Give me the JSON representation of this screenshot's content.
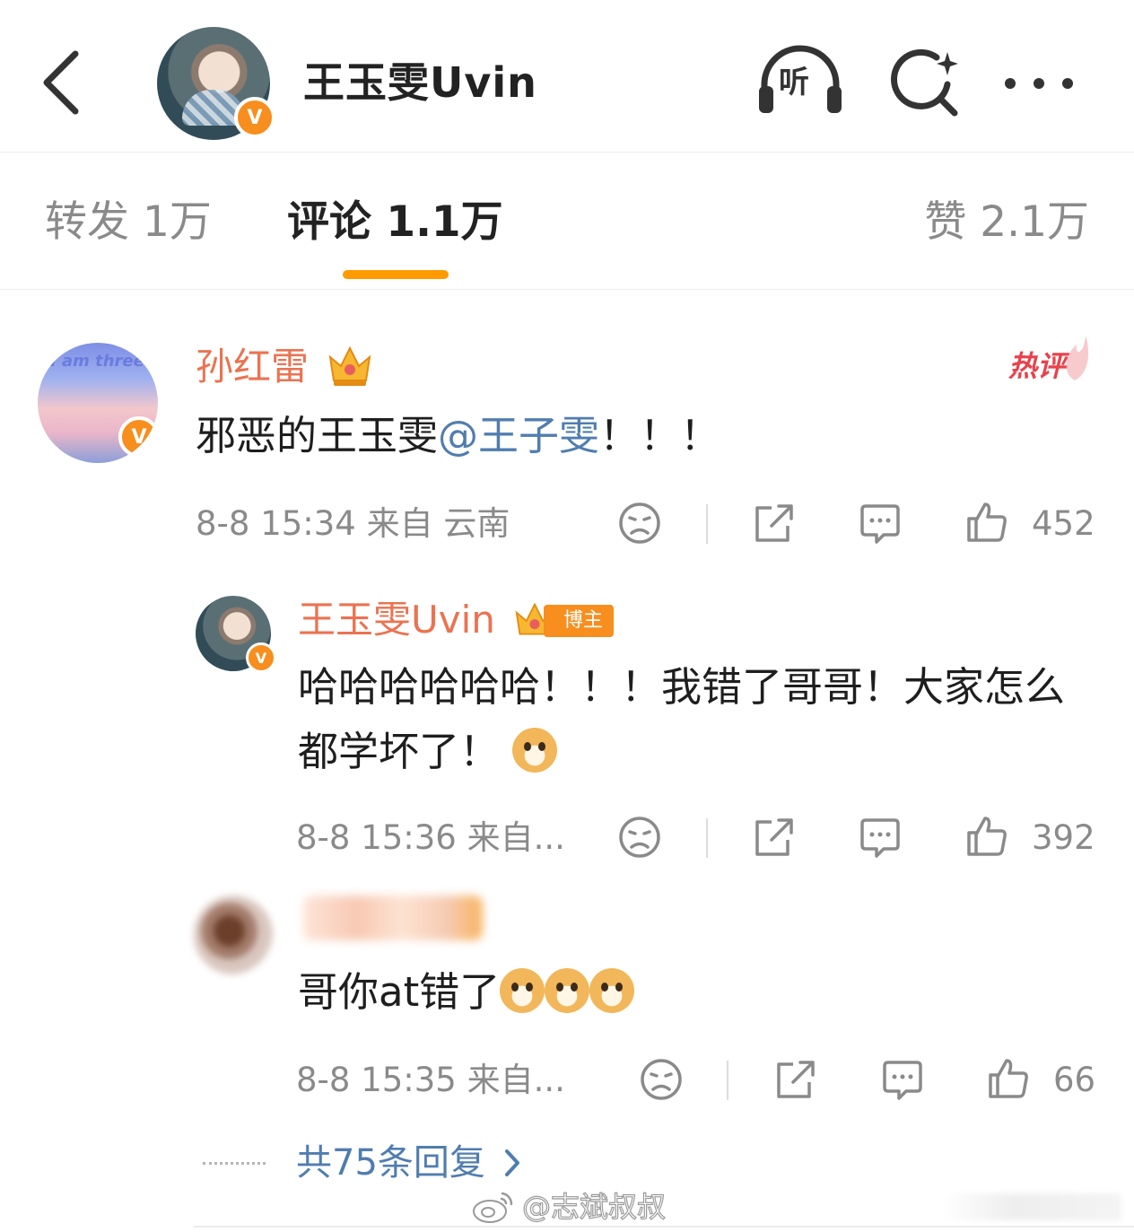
{
  "header": {
    "back_icon": "chevron-left-icon",
    "title": "王玉雯Uvin",
    "verified_badge": "V",
    "listen_label": "听",
    "search_icon": "search-sparkle-icon",
    "more_icon": "more-dots-icon"
  },
  "tabs": {
    "repost": "转发 1万",
    "comment": "评论 1.1万",
    "like": "赞 2.1万",
    "active_color": "#ff9a00"
  },
  "comments": [
    {
      "avatar_text": "I am three",
      "username": "孙红雷",
      "verified_badge": "V",
      "hot_tag": "热评",
      "content_prefix": "邪恶的王玉雯",
      "mention": "@王子雯",
      "content_suffix": "！！！",
      "meta": "8-8 15:34  来自 云南",
      "likes": "452"
    },
    {
      "username": "王玉雯Uvin",
      "verified_badge": "V",
      "blogger_badge": "博主",
      "content": "哈哈哈哈哈哈！！！我错了哥哥！大家怎么都学坏了！",
      "emoji": "doge-emoji",
      "meta": "8-8 15:36  来自...",
      "likes": "392"
    },
    {
      "content": "哥你at错了",
      "emoji": "doge-emoji",
      "meta": "8-8 15:35  来自...",
      "likes": "66"
    }
  ],
  "more_replies": "共75条回复",
  "watermark": "@志斌叔叔",
  "colors": {
    "username": "#eb7350",
    "mention": "#507daf",
    "badge": "#f78e1e",
    "hot": "#e8434c"
  }
}
